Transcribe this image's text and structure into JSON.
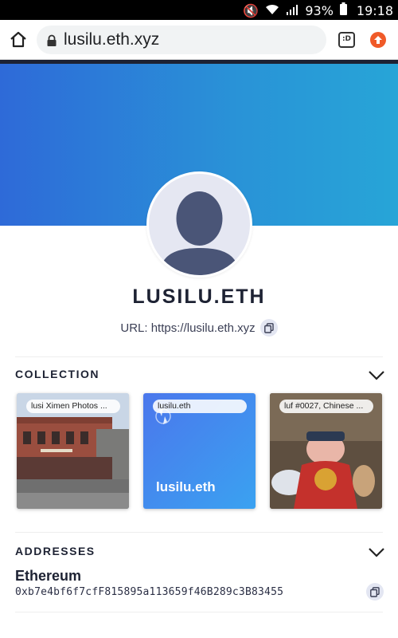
{
  "status_bar": {
    "battery": "93%",
    "time": "19:18"
  },
  "browser": {
    "url": "lusilu.eth.xyz",
    "tab_count": ":D"
  },
  "profile": {
    "name": "LUSILU.ETH",
    "url_text": "URL: https://lusilu.eth.xyz"
  },
  "collection": {
    "title": "COLLECTION",
    "items": [
      {
        "label": "lusi Ximen Photos ..."
      },
      {
        "label": "lusilu.eth",
        "display_name": "lusilu.eth"
      },
      {
        "label": "luf #0027, Chinese ..."
      }
    ]
  },
  "addresses": {
    "title": "ADDRESSES",
    "items": [
      {
        "chain": "Ethereum",
        "address": "0xb7e4bf6f7cfF815895a113659f46B289c3B83455"
      }
    ]
  },
  "colors": {
    "banner_start": "#2e6ad8",
    "banner_end": "#27a5d7",
    "text_dark": "#1d2233",
    "avatar_bg": "#e5e7f2",
    "avatar_figure": "#4a5577"
  }
}
